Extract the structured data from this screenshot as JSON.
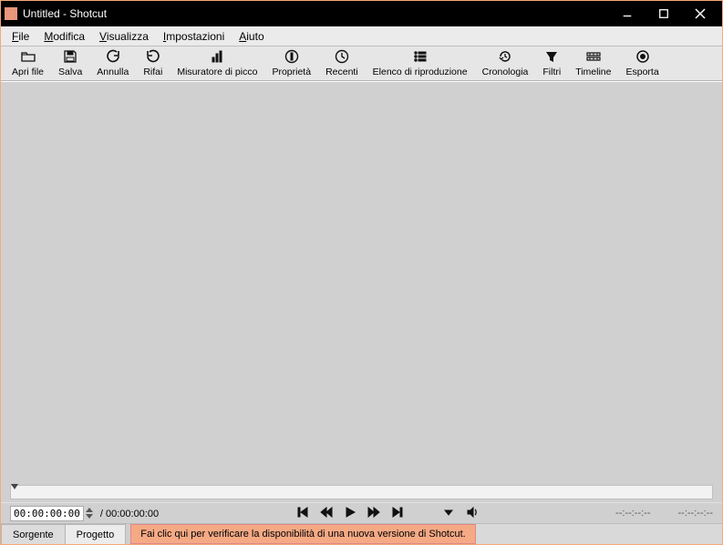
{
  "window": {
    "title": "Untitled - Shotcut"
  },
  "menu": {
    "items": [
      {
        "hotkey": "F",
        "rest": "ile"
      },
      {
        "hotkey": "M",
        "rest": "odifica"
      },
      {
        "hotkey": "V",
        "rest": "isualizza"
      },
      {
        "hotkey": "I",
        "rest": "mpostazioni"
      },
      {
        "hotkey": "A",
        "rest": "iuto"
      }
    ]
  },
  "toolbar": {
    "open": "Apri file",
    "save": "Salva",
    "undo": "Annulla",
    "redo": "Rifai",
    "peak": "Misuratore di picco",
    "props": "Proprietà",
    "recent": "Recenti",
    "playlist": "Elenco di riproduzione",
    "history": "Cronologia",
    "filters": "Filtri",
    "timeline": "Timeline",
    "export": "Esporta"
  },
  "transport": {
    "current": "00:00:00:00",
    "duration_prefix": "/ ",
    "duration": "00:00:00:00",
    "right_a": "--:--:--:--",
    "right_b": "--:--:--:--"
  },
  "tabs": {
    "source": "Sorgente",
    "project": "Progetto"
  },
  "status": {
    "update_msg": "Fai clic qui per verificare la disponibilità di una nuova versione di Shotcut."
  }
}
